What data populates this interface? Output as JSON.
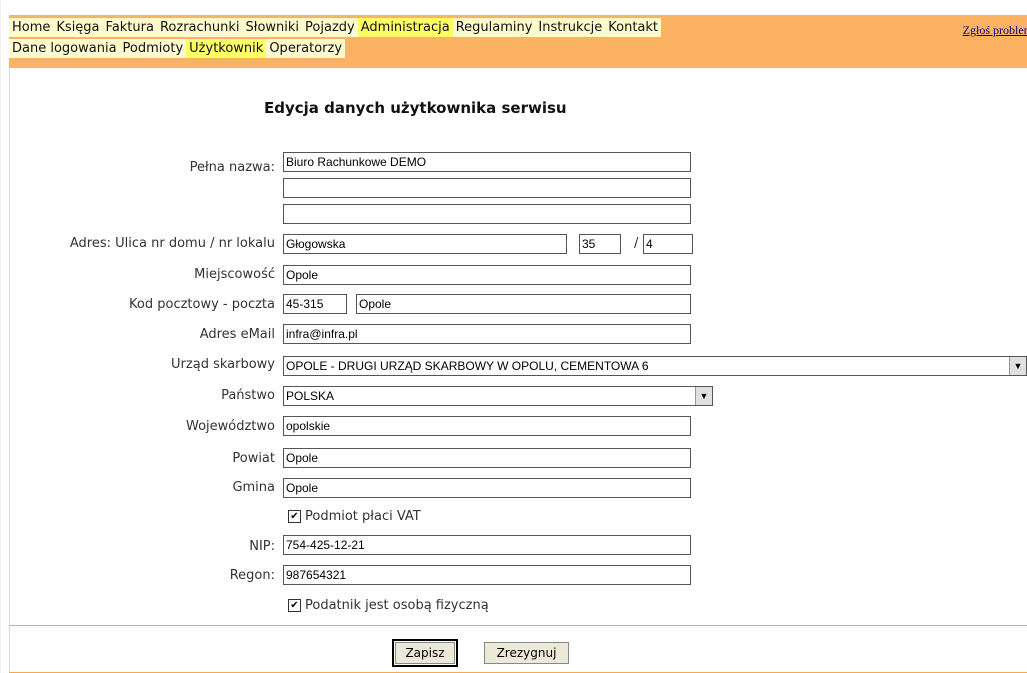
{
  "menu": {
    "row1": [
      {
        "label": "Home",
        "active": false
      },
      {
        "label": "Księga",
        "active": false
      },
      {
        "label": "Faktura",
        "active": false
      },
      {
        "label": "Rozrachunki",
        "active": false
      },
      {
        "label": "Słowniki",
        "active": false
      },
      {
        "label": "Pojazdy",
        "active": false
      },
      {
        "label": "Administracja",
        "active": true
      },
      {
        "label": "Regulaminy",
        "active": false
      },
      {
        "label": "Instrukcje",
        "active": false
      },
      {
        "label": "Kontakt",
        "active": false
      }
    ],
    "row2": [
      {
        "label": "Dane logowania",
        "active": false
      },
      {
        "label": "Podmioty",
        "active": false
      },
      {
        "label": "Użytkownik",
        "active": true
      },
      {
        "label": "Operatorzy",
        "active": false
      }
    ],
    "report_link": "Zgłoś problem"
  },
  "page_title": "Edycja danych użytkownika serwisu",
  "form": {
    "full_name_label": "Pełna nazwa:",
    "full_name_1": "Biuro Rachunkowe DEMO",
    "full_name_2": "",
    "full_name_3": "",
    "address_label": "Adres: Ulica nr domu / nr lokalu",
    "street": "Głogowska",
    "house_no": "35",
    "slash": "/",
    "flat_no": "4",
    "city_label": "Miejscowość",
    "city": "Opole",
    "postal_label": "Kod pocztowy - poczta",
    "postal_code": "45-315",
    "post_office": "Opole",
    "email_label": "Adres eMail",
    "email": "infra@infra.pl",
    "tax_office_label": "Urząd skarbowy",
    "tax_office": "OPOLE - DRUGI URZĄD SKARBOWY W OPOLU, CEMENTOWA 6",
    "country_label": "Państwo",
    "country": "POLSKA",
    "voivodeship_label": "Województwo",
    "voivodeship": "opolskie",
    "county_label": "Powiat",
    "county": "Opole",
    "commune_label": "Gmina",
    "commune": "Opole",
    "vat_checkbox_label": "Podmiot płaci VAT",
    "vat_checked": true,
    "nip_label": "NIP:",
    "nip": "754-425-12-21",
    "regon_label": "Regon:",
    "regon": "987654321",
    "natural_person_label": "Podatnik jest osobą fizyczną",
    "natural_person_checked": true
  },
  "buttons": {
    "save": "Zapisz",
    "cancel": "Zrezygnuj"
  },
  "colors": {
    "menu_bar": "#fbb363",
    "menu_item_bg": "#fffbcf",
    "menu_item_active": "#ffff66",
    "divider": "#f3a94c"
  },
  "icons": {
    "checkbox_checked": "✔",
    "dropdown_arrow": "▼"
  }
}
